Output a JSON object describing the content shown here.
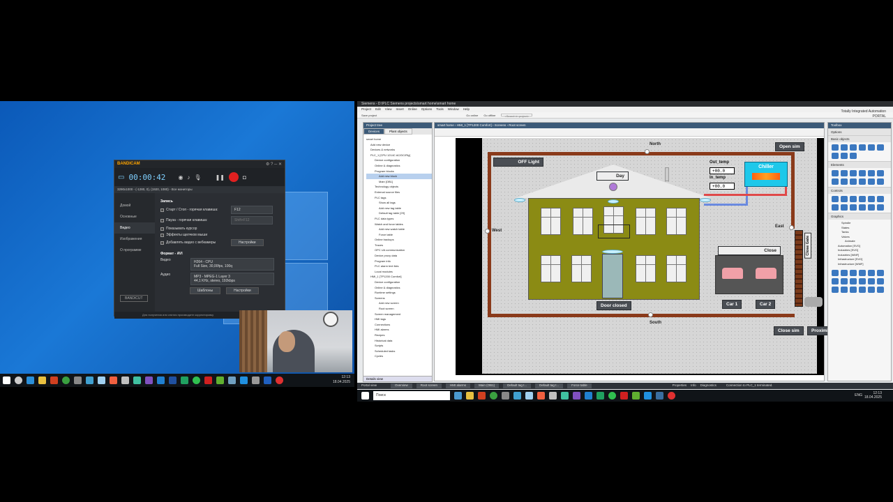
{
  "left": {
    "bandicam": {
      "brand": "BANDICAM",
      "timer": "00:00:42",
      "resolution_line": "3290x1000 - (-1280, 0), (1920, 1080) - Все мониторы",
      "sidebar": [
        "Домой",
        "Основные",
        "Видео",
        "Изображения",
        "О программе"
      ],
      "section_title": "Запись",
      "options": [
        {
          "label": "Старт / Стоп - горячая клавиша:",
          "value": "F12"
        },
        {
          "label": "Пауза - горячая клавиша:",
          "value": "Shift+F12"
        },
        {
          "label": "Показывать курсор",
          "value": ""
        },
        {
          "label": "Эффекты щелчков мыши",
          "value": ""
        },
        {
          "label": "Добавлять видео с вебкамеры",
          "value": ""
        }
      ],
      "settings_button": "Настройки",
      "format_title": "Формат - AVI",
      "video_label": "Видео",
      "video_codec": "H264 - CPU",
      "video_detail": "Full Size, 30,00fps, 100q",
      "audio_label": "Аудио",
      "audio_codec": "MP3 - MPEG-1 Layer 3",
      "audio_detail": "44,1 KHz, stereo, 192kbps",
      "templates_button": "Шаблоны",
      "settings_button2": "Настройки",
      "footer": "Для получения или снятия производите корректировку",
      "logo_button": "BANDICUT"
    },
    "taskbar_clock": {
      "time": "12:13",
      "date": "18.04.2025"
    }
  },
  "tia": {
    "title": "Siemens - D:\\PLC Siemens projects\\smart home\\smart home",
    "menu": [
      "Project",
      "Edit",
      "View",
      "Insert",
      "Online",
      "Options",
      "Tools",
      "Window",
      "Help"
    ],
    "brand_line1": "Totally Integrated Automation",
    "brand_line2": "PORTAL",
    "toolbar_items": [
      "Save project",
      "Go online",
      "Go offline"
    ],
    "search_placeholder": "<Search in project>",
    "project_tree_title": "Project tree",
    "tabs": [
      "Devices",
      "Plant objects"
    ],
    "tree": [
      "smart home",
      "Add new device",
      "Devices & networks",
      "PLC_1 [CPU 1214C AC/DC/Rly]",
      "Device configuration",
      "Online & diagnostics",
      "Program blocks",
      "Add new block",
      "Main [OB1]",
      "Technology objects",
      "External source files",
      "PLC tags",
      "Show all tags",
      "Add new tag table",
      "Default tag table [29]",
      "PLC data types",
      "Watch and force tables",
      "Add new watch table",
      "Force table",
      "Online backups",
      "Traces",
      "OPC UA communication",
      "Device proxy data",
      "Program info",
      "PLC alarm text lists",
      "Local modules",
      "HMI_1 [TP1200 Comfort]",
      "Device configuration",
      "Online & diagnostics",
      "Runtime settings",
      "Screens",
      "Add new screen",
      "Root screen",
      "Screen management",
      "HMI tags",
      "Connections",
      "HMI alarms",
      "Recipes",
      "Historical data",
      "Scripts",
      "Scheduled tasks",
      "Cycles"
    ],
    "details_view": "Details view",
    "breadcrumb": "smart home › HMI_1 [TP1200 Comfort] › Screens › Root screen",
    "screen": {
      "north": "North",
      "south": "South",
      "east": "East",
      "west": "West",
      "off_light": "OFF Light",
      "day": "Day",
      "out_temp_label": "Out_temp",
      "out_temp_value": "+00.0",
      "in_temp_label": "In_temp",
      "in_temp_value": "+00.0",
      "chiller": "Chiller",
      "open_sim": "Open sim",
      "close_sim": "Close sim",
      "proximity": "Proximi",
      "close": "Close",
      "close_gate": "Close Gate",
      "door_closed": "Door closed",
      "car1": "Car 1",
      "car2": "Car 2"
    },
    "toolbox_title": "Toolbox",
    "toolbox_sections": [
      "Options",
      "Basic objects",
      "Elements",
      "Controls",
      "Graphics"
    ],
    "graphics_tree": [
      "Spindle",
      "States",
      "Tanks",
      "Valves",
      "Animate",
      "Automation [SVG]",
      "Industries [SVG]",
      "Industries [WMF]",
      "Infrastructure [SVG]",
      "Infrastructure [WMF]"
    ],
    "status_tabs": [
      "Portal view",
      "Overview",
      "Root screen",
      "HMI alarms",
      "Main (OB1)",
      "Default tag t...",
      "Default tag t...",
      "Force table"
    ],
    "status_right": [
      "Properties",
      "Info",
      "Diagnostics"
    ],
    "status_message": "Connection to PLC_1 terminated.",
    "taskbar_search": "Поиск",
    "taskbar_lang": "ENG",
    "taskbar_clock": {
      "time": "12:13",
      "date": "18.04.2025"
    }
  }
}
